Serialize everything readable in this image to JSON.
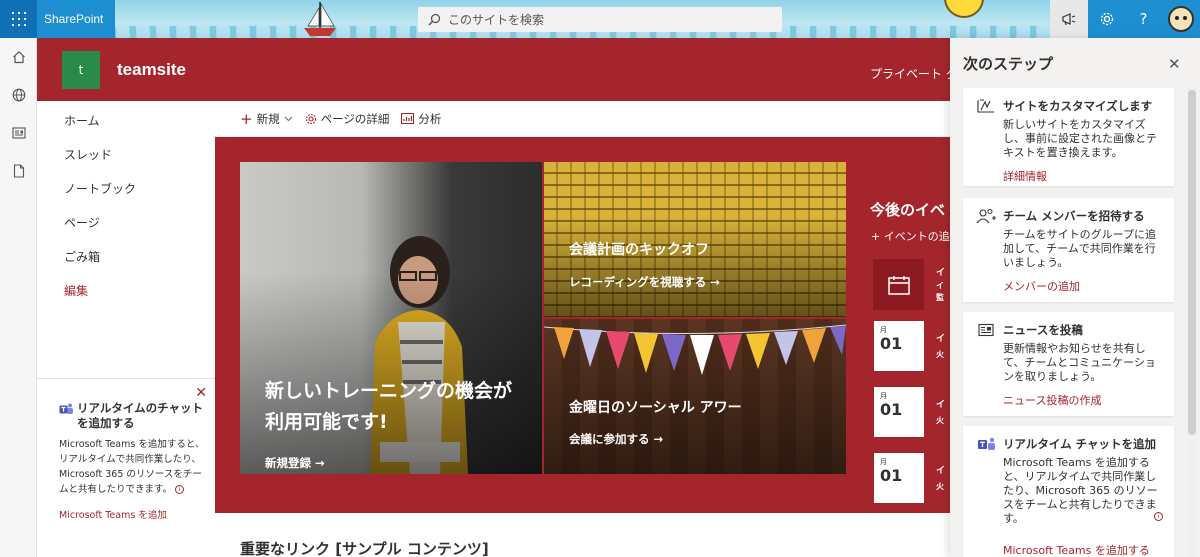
{
  "suitebar": {
    "brand": "SharePoint",
    "search_placeholder": "このサイトを検索",
    "help": "?"
  },
  "site": {
    "logo_letter": "t",
    "title": "teamsite",
    "privacy": "プライベート グ"
  },
  "nav": {
    "items": [
      {
        "label": "ホーム"
      },
      {
        "label": "スレッド"
      },
      {
        "label": "ノートブック"
      },
      {
        "label": "ページ"
      },
      {
        "label": "ごみ箱"
      }
    ],
    "edit": "編集"
  },
  "teams_promo": {
    "title": "リアルタイムのチャットを追加する",
    "body": "Microsoft Teams を追加すると、リアルタイムで共同作業したり、Microsoft 365 のリソースをチームと共有したりできます。",
    "link": "Microsoft Teams を追加",
    "close": "✕"
  },
  "cmdbar": {
    "new": "新規",
    "page_details": "ページの詳細",
    "analytics": "分析"
  },
  "hero": {
    "big": {
      "title": "新しいトレーニングの機会が利用可能です!",
      "link": "新規登録 →"
    },
    "top": {
      "title": "会議計画のキックオフ",
      "link": "レコーディングを視聴する →"
    },
    "bottom": {
      "title": "金曜日のソーシャル アワー",
      "link": "会議に参加する →"
    }
  },
  "events": {
    "title": "今後のイベ",
    "add": "+ イベントの追",
    "items": [
      {
        "month": "月",
        "day": "01",
        "line1": "イ",
        "line2": "火"
      },
      {
        "month": "月",
        "day": "01",
        "line1": "イ",
        "line2": "火"
      },
      {
        "month": "月",
        "day": "01",
        "line1": "イ",
        "line2": "火"
      }
    ],
    "first_lines": [
      "イ",
      "イ",
      "監"
    ]
  },
  "links_section": {
    "title": "重要なリンク [サンプル コンテンツ]"
  },
  "panel": {
    "title": "次のステップ",
    "close": "✕",
    "cards": [
      {
        "title": "サイトをカスタマイズします",
        "body": "新しいサイトをカスタマイズし、事前に設定された画像とテキストを置き換えます。",
        "link": "詳細情報",
        "icon": "customize-icon"
      },
      {
        "title": "チーム メンバーを招待する",
        "body": "チームをサイトのグループに追加して、チームで共同作業を行いましょう。",
        "link": "メンバーの追加",
        "icon": "add-people-icon"
      },
      {
        "title": "ニュースを投稿",
        "body": "更新情報やお知らせを共有して、チームとコミュニケーションを取りましょう。",
        "link": "ニュース投稿の作成",
        "icon": "news-icon"
      },
      {
        "title": "リアルタイム チャットを追加",
        "body": "Microsoft Teams を追加すると、リアルタイムで共同作業したり、Microsoft 365 のリソースをチームと共有したりできます。",
        "link": "Microsoft Teams を追加する",
        "icon": "teams-icon"
      }
    ]
  },
  "colors": {
    "accent": "#a4262c",
    "suite_blue": "#1d8fd0",
    "site_logo": "#2a8a49"
  }
}
